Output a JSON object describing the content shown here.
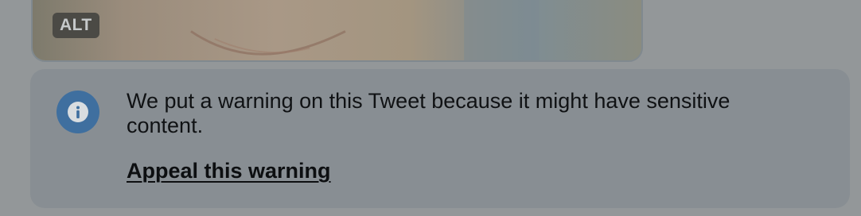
{
  "media": {
    "alt_badge": "ALT",
    "photo_icon": "sensitive-photo-thumbnail"
  },
  "warning": {
    "icon": "info-icon",
    "message": "We put a warning on this Tweet because it might have sensitive content.",
    "appeal_link": "Appeal this warning"
  },
  "colors": {
    "overlay_background": "#939799",
    "warning_box": "#888e93",
    "info_icon_circle": "#3f6f9f",
    "text": "#101214"
  }
}
